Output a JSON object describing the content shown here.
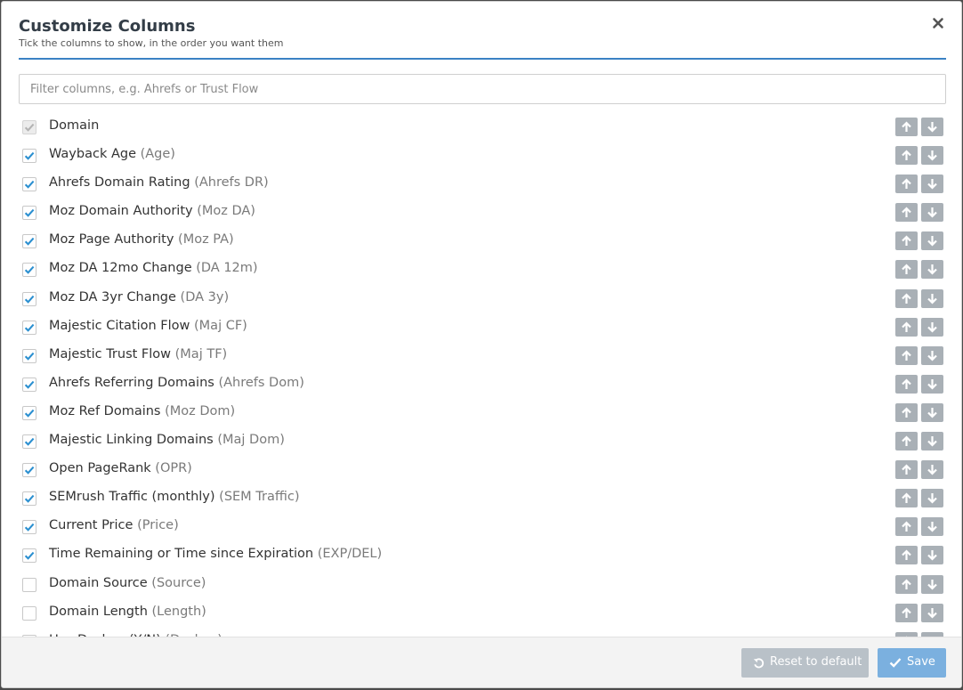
{
  "modal": {
    "title": "Customize Columns",
    "subtitle": "Tick the columns to show, in the order you want them"
  },
  "filter": {
    "placeholder": "Filter columns, e.g. Ahrefs or Trust Flow",
    "value": ""
  },
  "columns": [
    {
      "label": "Domain",
      "short": "",
      "checked": true,
      "disabled": true
    },
    {
      "label": "Wayback Age",
      "short": "(Age)",
      "checked": true
    },
    {
      "label": "Ahrefs Domain Rating",
      "short": "(Ahrefs DR)",
      "checked": true
    },
    {
      "label": "Moz Domain Authority",
      "short": "(Moz DA)",
      "checked": true
    },
    {
      "label": "Moz Page Authority",
      "short": "(Moz PA)",
      "checked": true
    },
    {
      "label": "Moz DA 12mo Change",
      "short": "(DA 12m)",
      "checked": true
    },
    {
      "label": "Moz DA 3yr Change",
      "short": "(DA 3y)",
      "checked": true
    },
    {
      "label": "Majestic Citation Flow",
      "short": "(Maj CF)",
      "checked": true
    },
    {
      "label": "Majestic Trust Flow",
      "short": "(Maj TF)",
      "checked": true
    },
    {
      "label": "Ahrefs Referring Domains",
      "short": "(Ahrefs Dom)",
      "checked": true
    },
    {
      "label": "Moz Ref Domains",
      "short": "(Moz Dom)",
      "checked": true
    },
    {
      "label": "Majestic Linking Domains",
      "short": "(Maj Dom)",
      "checked": true
    },
    {
      "label": "Open PageRank",
      "short": "(OPR)",
      "checked": true
    },
    {
      "label": "SEMrush Traffic (monthly)",
      "short": "(SEM Traffic)",
      "checked": true
    },
    {
      "label": "Current Price",
      "short": "(Price)",
      "checked": true
    },
    {
      "label": "Time Remaining or Time since Expiration",
      "short": "(EXP/DEL)",
      "checked": true
    },
    {
      "label": "Domain Source",
      "short": "(Source)",
      "checked": false
    },
    {
      "label": "Domain Length",
      "short": "(Length)",
      "checked": false
    },
    {
      "label": "Has Dashes (Y/N)",
      "short": "(Dashes)",
      "checked": false
    }
  ],
  "footer": {
    "reset_label": "Reset to default",
    "save_label": "Save"
  },
  "colors": {
    "accent": "#3b82c4",
    "check": "#2a8fd0",
    "arrow_button": "#a9b0b6",
    "reset_button": "#b9c1c8",
    "save_button": "#7bb0df"
  },
  "icons": {
    "close": "close-icon",
    "up": "arrow-up-icon",
    "down": "arrow-down-icon",
    "reset": "undo-icon",
    "save": "check-icon"
  }
}
